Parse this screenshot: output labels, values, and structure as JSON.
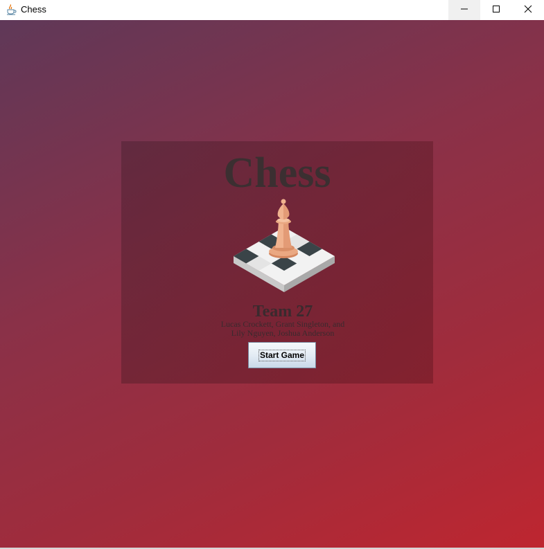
{
  "window": {
    "title": "Chess",
    "icon": "java-cup-icon",
    "controls": {
      "minimize": "minimize-icon",
      "maximize": "maximize-icon",
      "close": "close-icon"
    }
  },
  "menu": {
    "title": "Chess",
    "logo": "chess-bishop-on-board-icon",
    "team": "Team 27",
    "members_line1": "Lucas Crockett, Grant Singleton, and",
    "members_line2": "Lily Nguyen, Joshua Anderson",
    "start_button": "Start Game"
  },
  "colors": {
    "background_start": "#5f3858",
    "background_end": "#be2630",
    "title_text": "#3b2f31"
  }
}
